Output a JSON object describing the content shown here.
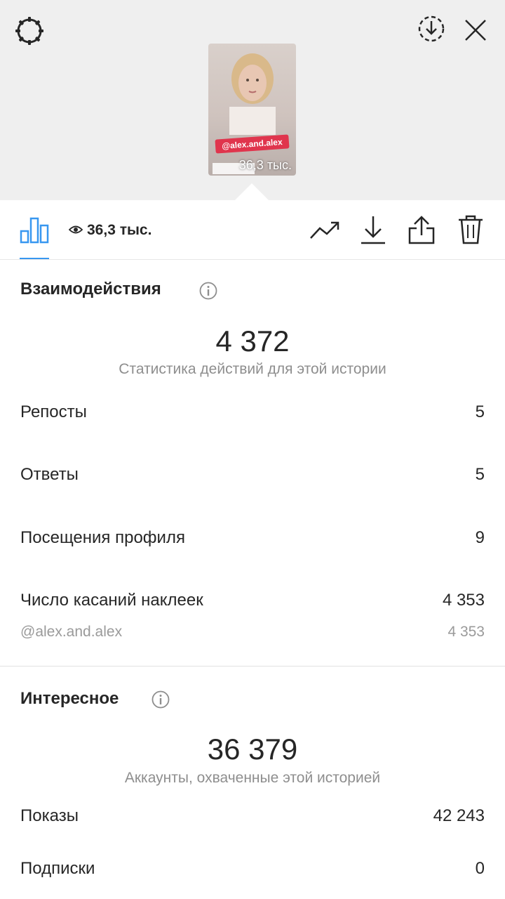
{
  "story": {
    "mention_sticker": "@alex.and.alex",
    "views_overlay": "36,3 тыс."
  },
  "toolbar": {
    "views": "36,3 тыс."
  },
  "icons": {
    "settings": "gear-icon",
    "download_circle": "download-circle-icon",
    "close": "close-icon",
    "insights": "bar-chart-icon",
    "eye": "eye-icon",
    "promote": "trending-up-icon",
    "download": "download-icon",
    "share": "share-icon",
    "delete": "trash-icon",
    "info": "info-icon"
  },
  "interactions": {
    "title": "Взаимодействия",
    "total": "4 372",
    "subtitle": "Статистика действий для этой истории",
    "rows": [
      {
        "label": "Репосты",
        "value": "5"
      },
      {
        "label": "Ответы",
        "value": "5"
      },
      {
        "label": "Посещения профиля",
        "value": "9"
      },
      {
        "label": "Число касаний наклеек",
        "value": "4 353"
      }
    ],
    "sticker_row": {
      "label": "@alex.and.alex",
      "value": "4 353"
    }
  },
  "discovery": {
    "title": "Интересное",
    "total": "36 379",
    "subtitle": "Аккаунты, охваченные этой историей",
    "rows": [
      {
        "label": "Показы",
        "value": "42 243"
      },
      {
        "label": "Подписки",
        "value": "0"
      }
    ]
  },
  "colors": {
    "accent": "#3897f0",
    "mention_sticker": "#e0354d",
    "text": "#262626",
    "muted": "#8e8e8e"
  }
}
